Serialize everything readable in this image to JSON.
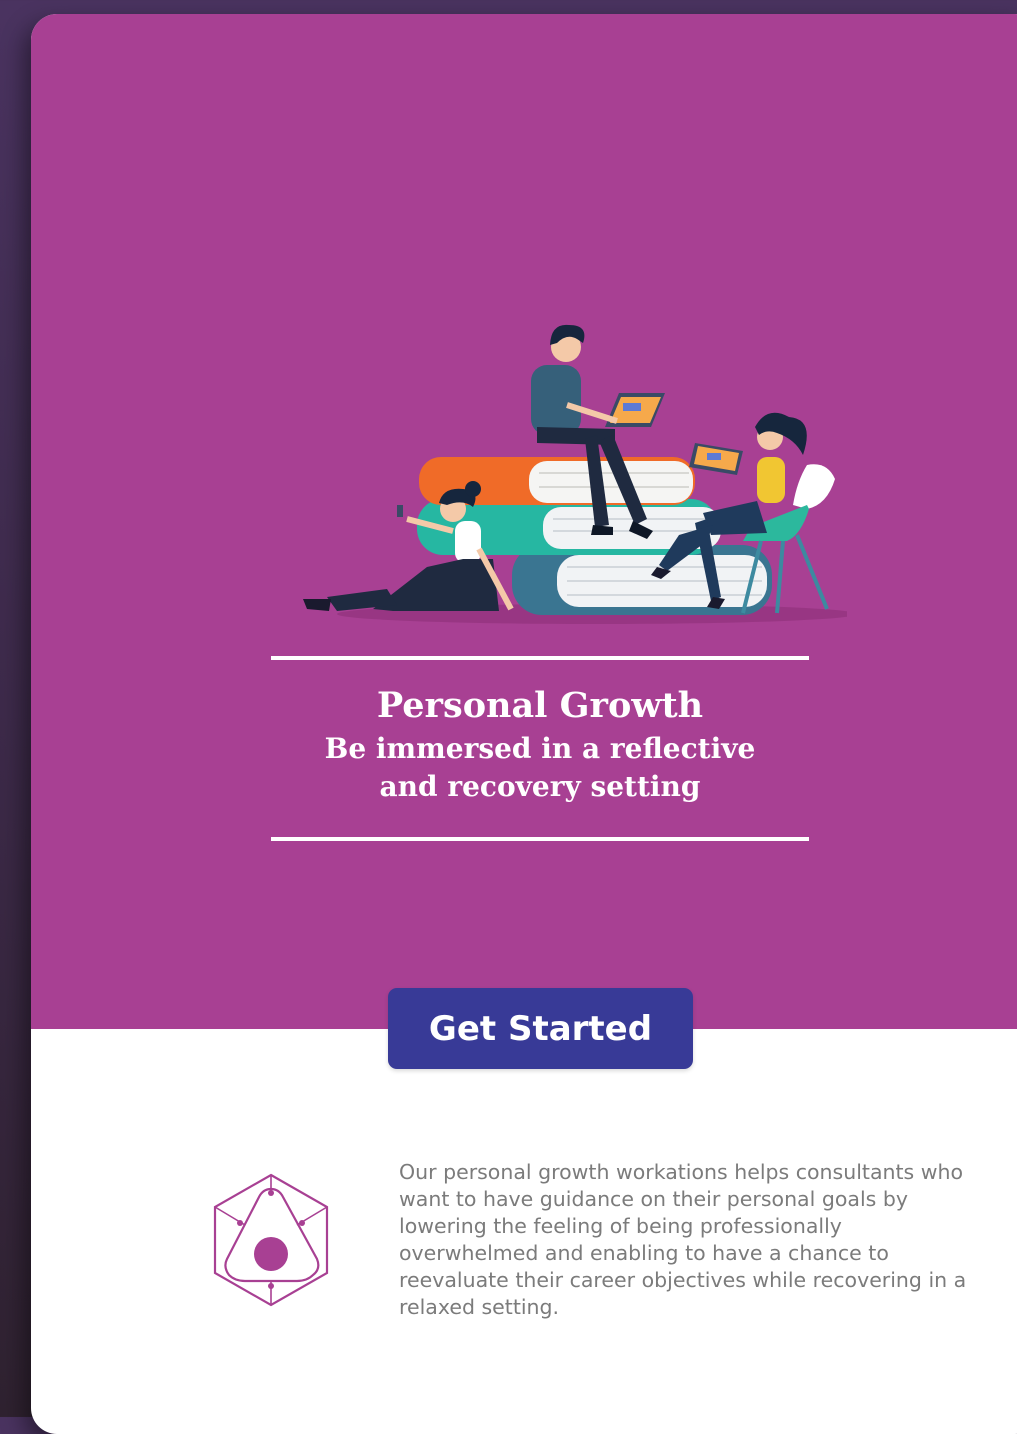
{
  "hero": {
    "title": "Personal Growth",
    "subtitle_line1": "Be immersed in a reflective",
    "subtitle_line2": "and recovery setting",
    "cta_label": "Get Started"
  },
  "feature": {
    "description": "Our personal growth workations helps consultants who want to have guidance on their personal goals by lowering the feeling of being professionally overwhelmed and enabling to have a chance to reevaluate their career objectives while recovering in a relaxed setting.",
    "icon": "hexagon-triangle-icon"
  },
  "colors": {
    "hero_bg": "#a84093",
    "cta_bg": "#383a97",
    "accent": "#a84093",
    "text_muted": "#7b7b7b"
  }
}
